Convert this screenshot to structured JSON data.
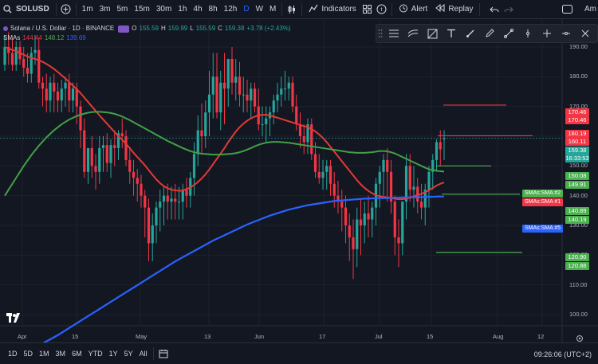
{
  "toolbar": {
    "symbol": "SOLUSD",
    "intervals": [
      "1m",
      "3m",
      "5m",
      "15m",
      "30m",
      "1h",
      "4h",
      "8h",
      "12h",
      "D",
      "W",
      "M"
    ],
    "active_interval": "D",
    "indicators_label": "Indicators",
    "alert_label": "Alert",
    "replay_label": "Replay",
    "profile_label": "Am"
  },
  "legend": {
    "title": "Solana / U.S. Dollar · 1D · BINANCE",
    "o_label": "O",
    "o_value": "155.59",
    "h_label": "H",
    "h_value": "159.99",
    "l_label": "L",
    "l_value": "155.59",
    "c_label": "C",
    "c_value": "159.38",
    "change": "+3.78 (+2.43%)",
    "sma_label": "SMAs",
    "sma1_value": "144.44",
    "sma2_value": "148.12",
    "sma5_value": "139.69"
  },
  "price_axis": {
    "ticks": [
      "190.00",
      "180.00",
      "170.00",
      "160.00",
      "150.00",
      "140.00",
      "130.00",
      "120.00",
      "110.00",
      "100.00"
    ],
    "labels": [
      {
        "text": "170.46",
        "color": "#f23645"
      },
      {
        "text": "170.46",
        "color": "#f23645"
      },
      {
        "text": "160.19",
        "color": "#f23645"
      },
      {
        "text": "160.11",
        "color": "#f23645"
      },
      {
        "text": "159.38",
        "color": "#26a69a"
      },
      {
        "text": "16:33:53",
        "color": "#26a69a"
      },
      {
        "text": "150.08",
        "color": "#4caf50"
      },
      {
        "text": "149.91",
        "color": "#4caf50"
      },
      {
        "text": "140.89",
        "color": "#4caf50"
      },
      {
        "text": "140.19",
        "color": "#4caf50"
      },
      {
        "text": "120.90",
        "color": "#4caf50"
      },
      {
        "text": "120.88",
        "color": "#4caf50"
      }
    ],
    "sma_tags": [
      {
        "text": "SMAs:SMA #2",
        "color": "#4caf50"
      },
      {
        "text": "SMAs:SMA #1",
        "color": "#f23645"
      },
      {
        "text": "SMAs:SMA #5",
        "color": "#2962ff"
      }
    ]
  },
  "time_axis": {
    "labels": [
      "Apr",
      "15",
      "May",
      "13",
      "Jun",
      "17",
      "Jul",
      "15",
      "Aug",
      "12"
    ]
  },
  "bottom": {
    "ranges": [
      "1D",
      "5D",
      "1M",
      "3M",
      "6M",
      "YTD",
      "1Y",
      "5Y",
      "All"
    ],
    "clock": "09:26:06 (UTC+2)"
  },
  "colors": {
    "up": "#26a69a",
    "down": "#f23645",
    "sma1": "#e53935",
    "sma2": "#43a047",
    "sma5": "#2962ff",
    "background": "#131722"
  },
  "chart_data": {
    "type": "candlestick",
    "symbol": "SOLUSD",
    "interval": "1D",
    "ylim": [
      95,
      200
    ],
    "dates": [
      "2024-03-23",
      "2024-03-24",
      "2024-03-25",
      "2024-03-26",
      "2024-03-27",
      "2024-03-28",
      "2024-03-29",
      "2024-03-30",
      "2024-03-31",
      "2024-04-01",
      "2024-04-02",
      "2024-04-03",
      "2024-04-04",
      "2024-04-05",
      "2024-04-06",
      "2024-04-07",
      "2024-04-08",
      "2024-04-09",
      "2024-04-10",
      "2024-04-11",
      "2024-04-12",
      "2024-04-13",
      "2024-04-14",
      "2024-04-15",
      "2024-04-16",
      "2024-04-17",
      "2024-04-18",
      "2024-04-19",
      "2024-04-20",
      "2024-04-21",
      "2024-04-22",
      "2024-04-23",
      "2024-04-24",
      "2024-04-25",
      "2024-04-26",
      "2024-04-27",
      "2024-04-28",
      "2024-04-29",
      "2024-04-30",
      "2024-05-01",
      "2024-05-02",
      "2024-05-03",
      "2024-05-04",
      "2024-05-05",
      "2024-05-06",
      "2024-05-07",
      "2024-05-08",
      "2024-05-09",
      "2024-05-10",
      "2024-05-11",
      "2024-05-12",
      "2024-05-13",
      "2024-05-14",
      "2024-05-15",
      "2024-05-16",
      "2024-05-17",
      "2024-05-18",
      "2024-05-19",
      "2024-05-20",
      "2024-05-21",
      "2024-05-22",
      "2024-05-23",
      "2024-05-24",
      "2024-05-25",
      "2024-05-26",
      "2024-05-27",
      "2024-05-28",
      "2024-05-29",
      "2024-05-30",
      "2024-05-31",
      "2024-06-01",
      "2024-06-02",
      "2024-06-03",
      "2024-06-04",
      "2024-06-05",
      "2024-06-06",
      "2024-06-07",
      "2024-06-08",
      "2024-06-09",
      "2024-06-10",
      "2024-06-11",
      "2024-06-12",
      "2024-06-13",
      "2024-06-14",
      "2024-06-15",
      "2024-06-16",
      "2024-06-17",
      "2024-06-18",
      "2024-06-19",
      "2024-06-20",
      "2024-06-21",
      "2024-06-22",
      "2024-06-23",
      "2024-06-24",
      "2024-06-25",
      "2024-06-26",
      "2024-06-27",
      "2024-06-28",
      "2024-06-29",
      "2024-06-30",
      "2024-07-01",
      "2024-07-02",
      "2024-07-03",
      "2024-07-04",
      "2024-07-05",
      "2024-07-06",
      "2024-07-07",
      "2024-07-08",
      "2024-07-09",
      "2024-07-10",
      "2024-07-11",
      "2024-07-12",
      "2024-07-13",
      "2024-07-14",
      "2024-07-15",
      "2024-07-16",
      "2024-07-17"
    ],
    "open": [
      184,
      190,
      188,
      184,
      190,
      186,
      183,
      181,
      188,
      189,
      178,
      176,
      172,
      178,
      175,
      172,
      176,
      178,
      172,
      176,
      170,
      162,
      148,
      156,
      150,
      148,
      156,
      157,
      151,
      157,
      156,
      161,
      160,
      152,
      148,
      146,
      144,
      140,
      136,
      124,
      130,
      136,
      138,
      140,
      138,
      139,
      138,
      138,
      142,
      140,
      146,
      154,
      162,
      160,
      168,
      174,
      180,
      168,
      178,
      176,
      186,
      178,
      180,
      174,
      174,
      172,
      176,
      170,
      164,
      164,
      166,
      168,
      172,
      174,
      176,
      176,
      178,
      170,
      164,
      160,
      158,
      164,
      154,
      148,
      146,
      148,
      150,
      144,
      140,
      138,
      136,
      130,
      126,
      122,
      132,
      130,
      134,
      132,
      136,
      144,
      148,
      152,
      148,
      138,
      126,
      124,
      138,
      150,
      142,
      143,
      138,
      136,
      142,
      148,
      152,
      158,
      159
    ],
    "high": [
      194,
      195,
      193,
      192,
      192,
      190,
      188,
      190,
      194,
      193,
      180,
      181,
      180,
      181,
      178,
      179,
      180,
      181,
      178,
      178,
      172,
      166,
      156,
      160,
      154,
      160,
      160,
      161,
      159,
      162,
      162,
      166,
      162,
      156,
      152,
      149,
      147,
      142,
      139,
      134,
      138,
      142,
      143,
      144,
      143,
      144,
      143,
      144,
      146,
      148,
      158,
      167,
      171,
      172,
      182,
      188,
      188,
      182,
      188,
      186,
      190,
      186,
      185,
      180,
      179,
      178,
      178,
      176,
      170,
      170,
      170,
      174,
      178,
      180,
      182,
      180,
      180,
      174,
      168,
      164,
      166,
      166,
      158,
      154,
      152,
      152,
      152,
      148,
      145,
      142,
      140,
      134,
      132,
      136,
      139,
      138,
      140,
      138,
      146,
      150,
      154,
      156,
      152,
      140,
      132,
      138,
      154,
      154,
      150,
      146,
      144,
      144,
      150,
      154,
      159,
      162,
      162
    ],
    "low": [
      182,
      184,
      182,
      182,
      184,
      180,
      178,
      178,
      184,
      176,
      170,
      168,
      168,
      168,
      168,
      168,
      170,
      168,
      168,
      164,
      156,
      146,
      144,
      146,
      142,
      144,
      148,
      148,
      146,
      150,
      152,
      156,
      150,
      144,
      140,
      138,
      136,
      126,
      118,
      118,
      124,
      128,
      130,
      132,
      132,
      132,
      132,
      132,
      136,
      136,
      140,
      150,
      154,
      156,
      160,
      166,
      166,
      162,
      164,
      170,
      174,
      172,
      170,
      168,
      168,
      166,
      168,
      162,
      160,
      158,
      160,
      164,
      168,
      170,
      172,
      172,
      168,
      162,
      156,
      154,
      154,
      152,
      146,
      144,
      142,
      142,
      140,
      136,
      134,
      128,
      124,
      118,
      112,
      116,
      120,
      124,
      126,
      126,
      130,
      136,
      140,
      138,
      134,
      120,
      116,
      120,
      132,
      138,
      136,
      134,
      132,
      130,
      136,
      142,
      148,
      150,
      152
    ],
    "close": [
      190,
      188,
      184,
      190,
      186,
      183,
      181,
      188,
      189,
      178,
      176,
      172,
      178,
      175,
      172,
      176,
      178,
      172,
      176,
      170,
      162,
      148,
      156,
      150,
      148,
      156,
      157,
      151,
      157,
      156,
      161,
      160,
      152,
      148,
      146,
      144,
      140,
      136,
      124,
      130,
      136,
      138,
      140,
      138,
      139,
      138,
      138,
      142,
      140,
      146,
      154,
      162,
      160,
      168,
      174,
      180,
      168,
      178,
      176,
      186,
      178,
      180,
      174,
      174,
      172,
      176,
      170,
      164,
      164,
      166,
      168,
      172,
      174,
      176,
      176,
      178,
      170,
      164,
      160,
      158,
      164,
      154,
      148,
      146,
      148,
      150,
      144,
      140,
      138,
      136,
      130,
      126,
      122,
      132,
      130,
      134,
      132,
      136,
      144,
      148,
      152,
      148,
      138,
      126,
      124,
      138,
      150,
      142,
      143,
      138,
      136,
      142,
      148,
      152,
      158,
      155.59,
      159.38
    ],
    "series": [
      {
        "name": "SMAs:SMA #1",
        "color": "#e53935",
        "values": [
          190,
          189.5,
          189,
          188.6,
          188,
          187.4,
          186.8,
          186.3,
          186,
          185.5,
          185,
          184.3,
          183.5,
          182.6,
          181.6,
          180.5,
          179.4,
          178.2,
          177,
          175.8,
          174.5,
          173,
          171.5,
          170,
          168.5,
          167,
          165.6,
          164.2,
          162.8,
          161.4,
          160,
          158.8,
          157.4,
          156,
          154.4,
          153,
          151.6,
          150.2,
          148.6,
          147,
          145.5,
          144.2,
          143.2,
          142.5,
          142,
          141.8,
          141.6,
          141.8,
          142.2,
          142.8,
          143.6,
          144.6,
          145.8,
          147.2,
          148.8,
          150.6,
          152.4,
          154.2,
          156,
          158,
          159.8,
          161.6,
          163,
          164.2,
          165.2,
          166,
          166.6,
          167,
          167.2,
          167.2,
          167,
          166.6,
          166.2,
          165.8,
          165.4,
          165,
          164.6,
          164.2,
          163.8,
          163.4,
          163,
          162.4,
          161.6,
          160.6,
          159.4,
          158,
          156.4,
          154.8,
          153.2,
          151.6,
          150,
          148.4,
          146.8,
          145.2,
          143.8,
          142.6,
          141.6,
          140.8,
          140.2,
          139.8,
          139.6,
          139.4,
          139.2,
          139,
          138.8,
          138.8,
          139,
          139.4,
          139.8,
          140.2,
          140.6,
          141.2,
          141.8,
          142.6,
          143.4,
          144,
          144.44
        ]
      },
      {
        "name": "SMAs:SMA #2",
        "color": "#43a047",
        "values": [
          140,
          142,
          144,
          146,
          148,
          150,
          151.8,
          153.6,
          155.2,
          156.8,
          158.2,
          159.6,
          160.8,
          162,
          163,
          164,
          164.8,
          165.6,
          166.2,
          166.8,
          167.2,
          167.6,
          167.9,
          168.1,
          168.2,
          168.2,
          168.1,
          168,
          167.8,
          167.5,
          167.1,
          166.6,
          166,
          165.4,
          164.7,
          164,
          163.3,
          162.6,
          161.9,
          161.2,
          160.5,
          159.8,
          159.1,
          158.4,
          157.8,
          157.2,
          156.6,
          156,
          155.5,
          155,
          154.6,
          154.3,
          154.1,
          154,
          153.9,
          153.8,
          153.8,
          153.8,
          153.9,
          154,
          154.1,
          154.3,
          154.6,
          155,
          155.5,
          156,
          156.6,
          157.1,
          157.5,
          157.8,
          158,
          158.1,
          158.1,
          158,
          157.9,
          157.8,
          157.6,
          157.4,
          157.2,
          157,
          156.8,
          156.6,
          156.4,
          156.2,
          156,
          155.8,
          155.6,
          155.4,
          155.2,
          155,
          154.8,
          154.6,
          154.5,
          154.4,
          154.4,
          154.4,
          154.5,
          154.6,
          154.8,
          155,
          155,
          154.9,
          154.6,
          154.2,
          153.6,
          153,
          152.4,
          151.8,
          151.2,
          150.6,
          150,
          149.4,
          148.9,
          148.6,
          148.4,
          148.2,
          148.12
        ]
      },
      {
        "name": "SMAs:SMA #5",
        "color": "#2962ff",
        "values": [
          84,
          84.6,
          85.2,
          85.8,
          86.4,
          87,
          87.6,
          88.2,
          88.9,
          89.6,
          90.3,
          91,
          91.7,
          92.4,
          93.1,
          93.9,
          94.7,
          95.5,
          96.3,
          97.1,
          97.9,
          98.7,
          99.5,
          100.3,
          101.1,
          101.9,
          102.7,
          103.5,
          104.3,
          105.1,
          105.9,
          106.7,
          107.5,
          108.3,
          109.1,
          109.9,
          110.7,
          111.5,
          112.3,
          113.1,
          113.9,
          114.7,
          115.5,
          116.3,
          117.1,
          117.9,
          118.6,
          119.3,
          120,
          120.7,
          121.4,
          122.1,
          122.8,
          123.5,
          124.2,
          124.9,
          125.5,
          126.1,
          126.7,
          127.3,
          127.9,
          128.5,
          129.1,
          129.7,
          130.3,
          130.8,
          131.3,
          131.8,
          132.3,
          132.8,
          133.3,
          133.7,
          134.1,
          134.5,
          134.9,
          135.3,
          135.6,
          135.9,
          136.2,
          136.5,
          136.8,
          137,
          137.2,
          137.4,
          137.6,
          137.8,
          138,
          138.2,
          138.3,
          138.4,
          138.5,
          138.6,
          138.7,
          138.8,
          138.9,
          139,
          139,
          139.1,
          139.1,
          139.2,
          139.2,
          139.2,
          139.3,
          139.3,
          139.3,
          139.4,
          139.4,
          139.4,
          139.5,
          139.5,
          139.5,
          139.6,
          139.6,
          139.6,
          139.7,
          139.7,
          139.69
        ]
      }
    ],
    "horizontal_levels": [
      {
        "price": 170.46,
        "color": "#f23645"
      },
      {
        "price": 160.15,
        "color": "#f23645"
      },
      {
        "price": 150.0,
        "color": "#4caf50"
      },
      {
        "price": 140.5,
        "color": "#4caf50"
      },
      {
        "price": 120.89,
        "color": "#4caf50"
      }
    ]
  }
}
